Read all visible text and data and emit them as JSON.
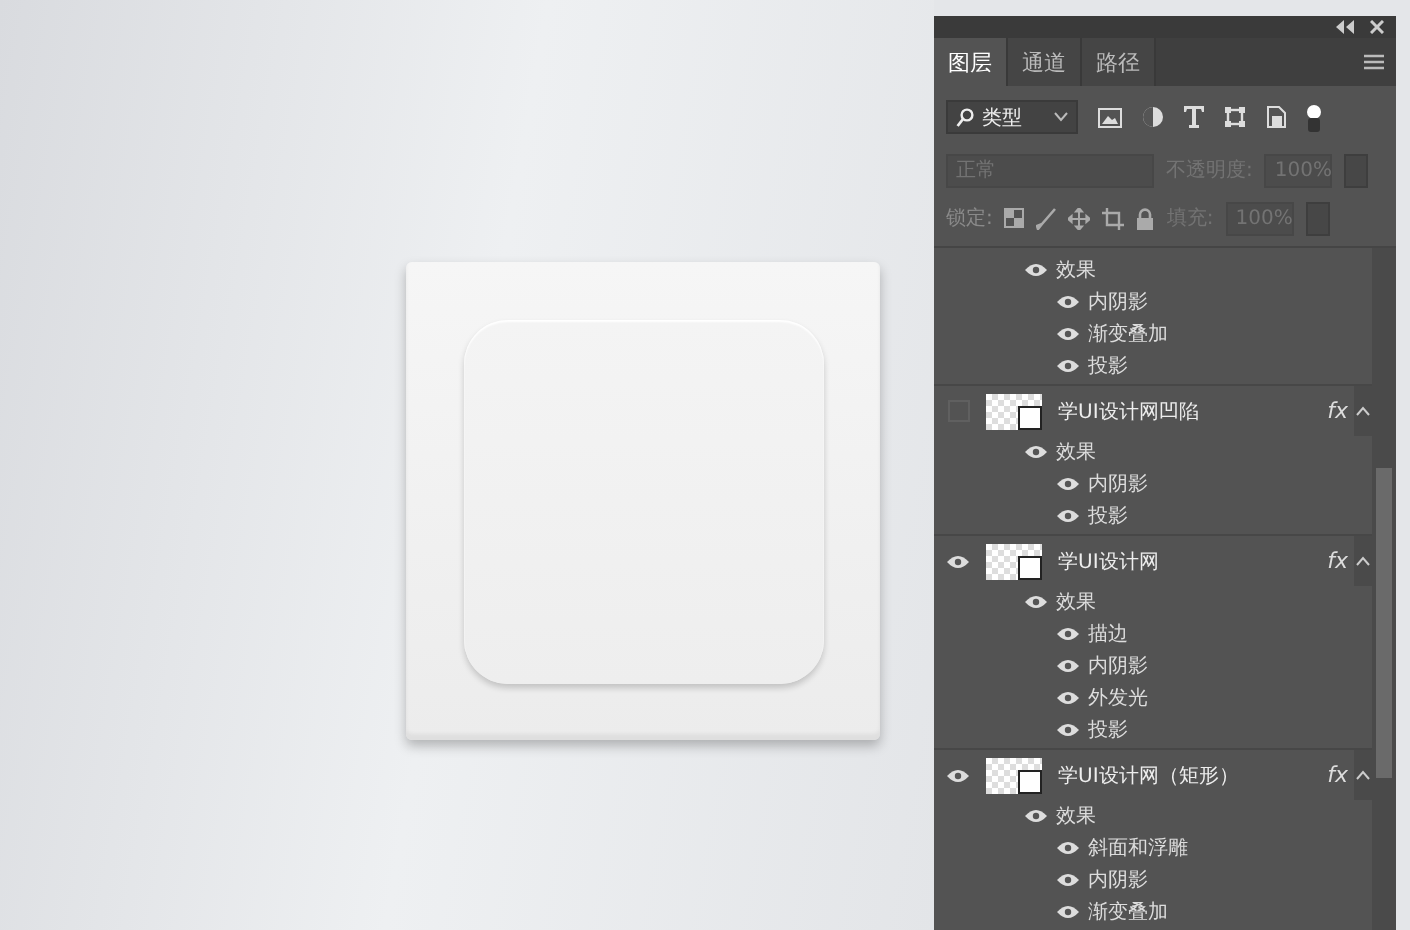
{
  "panel": {
    "tabs": [
      {
        "label": "图层",
        "selected": true
      },
      {
        "label": "通道",
        "selected": false
      },
      {
        "label": "路径",
        "selected": false
      }
    ],
    "filter": {
      "value": "类型"
    },
    "blend_mode": {
      "value": "正常",
      "disabled": true
    },
    "opacity": {
      "label": "不透明度:",
      "value": "100%",
      "disabled": true
    },
    "lock_label": "锁定:",
    "fill": {
      "label": "填充:",
      "value": "100%",
      "disabled": true
    },
    "layers": [
      {
        "kind": "continued",
        "children": [
          {
            "name": "效果",
            "visible": true,
            "children": [
              {
                "name": "内阴影",
                "visible": true
              },
              {
                "name": "渐变叠加",
                "visible": true
              },
              {
                "name": "投影",
                "visible": true
              }
            ]
          }
        ]
      },
      {
        "kind": "layer",
        "name": "学UI设计网凹陷",
        "visible": false,
        "fx": "fx",
        "children": [
          {
            "name": "效果",
            "visible": true,
            "children": [
              {
                "name": "内阴影",
                "visible": true
              },
              {
                "name": "投影",
                "visible": true
              }
            ]
          }
        ]
      },
      {
        "kind": "layer",
        "name": "学UI设计网",
        "visible": true,
        "fx": "fx",
        "children": [
          {
            "name": "效果",
            "visible": true,
            "children": [
              {
                "name": "描边",
                "visible": true
              },
              {
                "name": "内阴影",
                "visible": true
              },
              {
                "name": "外发光",
                "visible": true
              },
              {
                "name": "投影",
                "visible": true
              }
            ]
          }
        ]
      },
      {
        "kind": "layer",
        "name": "学UI设计网（矩形）",
        "visible": true,
        "fx": "fx",
        "children": [
          {
            "name": "效果",
            "visible": true,
            "children": [
              {
                "name": "斜面和浮雕",
                "visible": true
              },
              {
                "name": "内阴影",
                "visible": true
              },
              {
                "name": "渐变叠加",
                "visible": true
              }
            ]
          }
        ]
      }
    ]
  }
}
